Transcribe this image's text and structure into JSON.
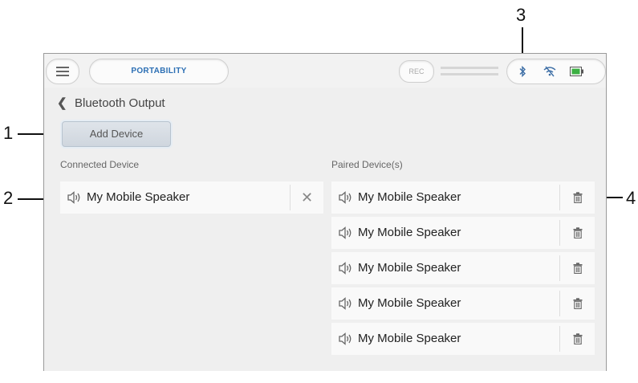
{
  "callouts": [
    "1",
    "2",
    "3",
    "4"
  ],
  "header": {
    "mode_label": "PORTABILITY",
    "rec_label": "REC",
    "status_icons": [
      "bluetooth-icon",
      "wifi-off-icon",
      "battery-icon"
    ]
  },
  "page": {
    "back_title": "Bluetooth Output",
    "add_device_label": "Add Device"
  },
  "connected": {
    "label": "Connected Device",
    "device": {
      "name": "My Mobile Speaker",
      "icon": "speaker-icon",
      "action_icon": "close-icon"
    }
  },
  "paired": {
    "label": "Paired Device(s)",
    "devices": [
      {
        "name": "My Mobile Speaker",
        "icon": "speaker-icon",
        "action_icon": "trash-icon"
      },
      {
        "name": "My Mobile Speaker",
        "icon": "speaker-icon",
        "action_icon": "trash-icon"
      },
      {
        "name": "My Mobile Speaker",
        "icon": "speaker-icon",
        "action_icon": "trash-icon"
      },
      {
        "name": "My Mobile Speaker",
        "icon": "speaker-icon",
        "action_icon": "trash-icon"
      },
      {
        "name": "My Mobile Speaker",
        "icon": "speaker-icon",
        "action_icon": "trash-icon"
      }
    ]
  },
  "colors": {
    "accent": "#2c6fb4",
    "status_icon": "#3e6fa6",
    "battery": "#3cb043"
  }
}
